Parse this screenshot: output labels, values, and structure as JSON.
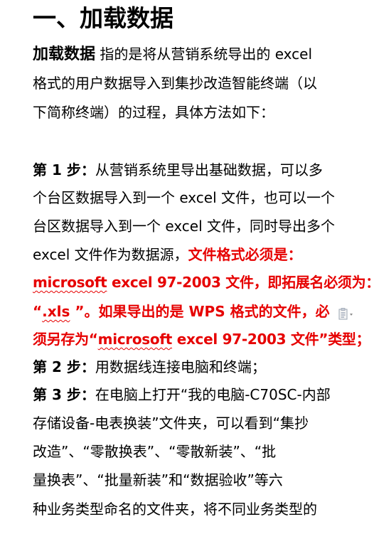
{
  "heading": "一、加载数据",
  "intro": {
    "lead": "加载数据",
    "l1": " 指的是将从营销系统导出的 excel",
    "l2": "格式的用户数据导入到集抄改造智能终端（以",
    "l3": "下简称终端）的过程，具体方法如下："
  },
  "step1": {
    "label": "第 1 步：",
    "l1": "从营销系统里导出基础数据，可以多",
    "l2": "个台区数据导入到一个 excel 文件，也可以一个",
    "l3": "台区数据导入到一个 excel 文件，同时导出多个",
    "l4_a": "excel 文件作为数据源，",
    "l4_b": "文件格式必须是：",
    "l5_a": "microsoft",
    "l5_b": " excel 97-2003 文件，即拓展名必须为：",
    "l6_a": "“",
    "l6_b": ".xls",
    "l6_c": " ”。如果导出的是 WPS 格式的文件，必",
    "l7_a": "须另存为“",
    "l7_b": "microsoft",
    "l7_c": " excel 97-2003 文件”类型；"
  },
  "step2": {
    "label": "第 2 步：",
    "text": "用数据线连接电脑和终端；"
  },
  "step3": {
    "label": "第 3 步：",
    "l1": "在电脑上打开“我的电脑-C70SC-内部",
    "l2": "存储设备-电表换装”文件夹，可以看到“集抄",
    "l3": "改造”、“零散换表”、“零散新装”、“批",
    "l4": "量换表”、“批量新装”和“数据验收”等六",
    "l5": "种业务类型命名的文件夹，将不同业务类型的"
  },
  "colors": {
    "emphasis": "#e60000",
    "text": "#000000"
  },
  "icons": {
    "paste_options": "paste-options-icon"
  }
}
